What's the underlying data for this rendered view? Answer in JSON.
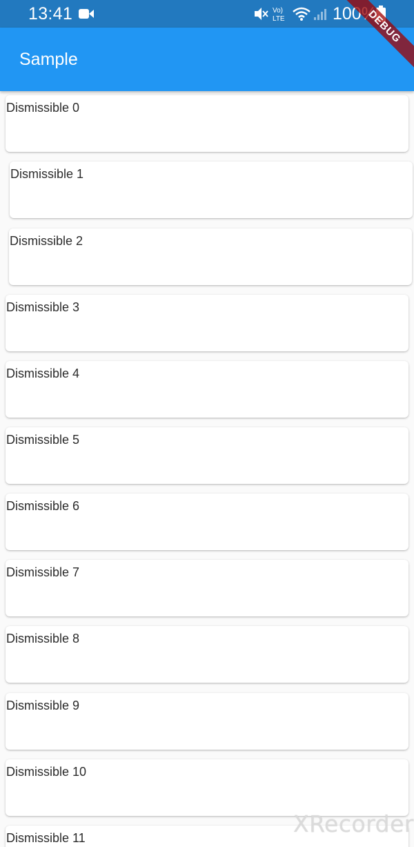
{
  "status_bar": {
    "time": "13:41",
    "battery": "100%",
    "network": "Vo) LTE",
    "icons": [
      "video-camera-icon",
      "mute-icon",
      "wifi-icon",
      "signal-icon",
      "battery-icon"
    ]
  },
  "app_bar": {
    "title": "Sample"
  },
  "debug_banner": "DEBUG",
  "list": {
    "items": [
      "Dismissible 0",
      "Dismissible 1",
      "Dismissible 2",
      "Dismissible 3",
      "Dismissible 4",
      "Dismissible 5",
      "Dismissible 6",
      "Dismissible 7",
      "Dismissible 8",
      "Dismissible 9",
      "Dismissible 10",
      "Dismissible 11"
    ]
  },
  "watermark": "XRecorder",
  "colors": {
    "status_bar": "#2279bf",
    "app_bar": "#2196f3",
    "background": "#fafafa",
    "card": "#ffffff"
  }
}
